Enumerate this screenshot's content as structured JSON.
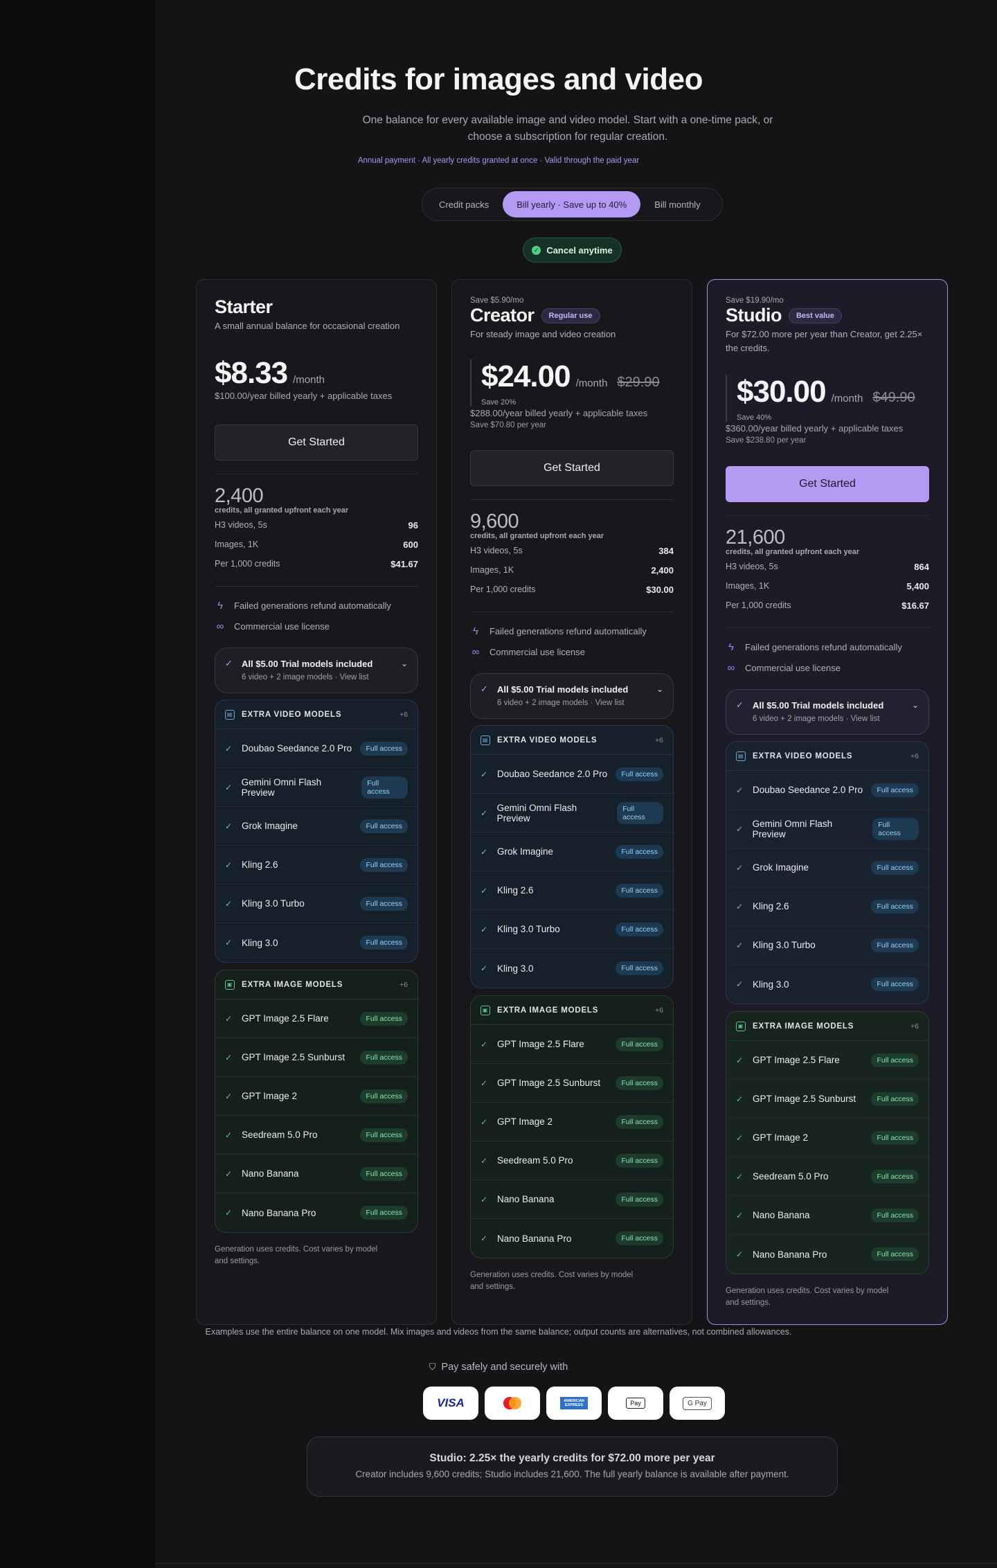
{
  "hero": {
    "title": "Credits for images and video",
    "subtitle": "One balance for every available image and video model. Start with a one-time pack, or choose a subscription for regular creation.",
    "note": "Annual payment · All yearly credits granted at once · Valid through the paid year"
  },
  "billing_toggle": {
    "options": [
      "Credit packs",
      "Bill yearly · Save up to 40%",
      "Bill monthly"
    ],
    "selected": "Bill yearly · Save up to 40%"
  },
  "cancel_badge": "Cancel anytime",
  "common": {
    "per_month": "/month",
    "credits_label": "credits, all granted upfront each year",
    "stat_labels": [
      "H3 videos, 5s",
      "Images, 1K",
      "Per 1,000 credits"
    ],
    "features": [
      "Failed generations refund automatically",
      "Commercial use license"
    ],
    "trial_title": "All $5.00 Trial models included",
    "trial_sub": "6 video + 2 image models · View list",
    "video_group_title": "EXTRA VIDEO MODELS",
    "image_group_title": "EXTRA IMAGE MODELS",
    "group_count": "+6",
    "full_access": "Full access",
    "video_models": [
      "Doubao Seedance 2.0 Pro",
      "Gemini Omni Flash Preview",
      "Grok Imagine",
      "Kling 2.6",
      "Kling 3.0 Turbo",
      "Kling 3.0"
    ],
    "image_models": [
      "GPT Image 2.5 Flare",
      "GPT Image 2.5 Sunburst",
      "GPT Image 2",
      "Seedream 5.0 Pro",
      "Nano Banana",
      "Nano Banana Pro"
    ],
    "gen_note": "Generation uses credits. Cost varies by model and settings."
  },
  "plans": [
    {
      "name": "Starter",
      "save_top": "",
      "tag": "",
      "desc": "A small annual balance for occasional creation",
      "price": "$8.33",
      "strike": "",
      "save_pct": "",
      "billed": "$100.00/year billed yearly + applicable taxes",
      "save_year": "",
      "cta": "Get Started",
      "credits": "2,400",
      "stats": [
        "96",
        "600",
        "$41.67"
      ]
    },
    {
      "name": "Creator",
      "save_top": "Save $5.90/mo",
      "tag": "Regular use",
      "desc": "For steady image and video creation",
      "price": "$24.00",
      "strike": "$29.90",
      "save_pct": "Save 20%",
      "billed": "$288.00/year billed yearly + applicable taxes",
      "save_year": "Save $70.80 per year",
      "cta": "Get Started",
      "credits": "9,600",
      "stats": [
        "384",
        "2,400",
        "$30.00"
      ]
    },
    {
      "name": "Studio",
      "save_top": "Save $19.90/mo",
      "tag": "Best value",
      "desc": "For $72.00 more per year than Creator, get 2.25× the credits.",
      "price": "$30.00",
      "strike": "$49.90",
      "save_pct": "Save 40%",
      "billed": "$360.00/year billed yearly + applicable taxes",
      "save_year": "Save $238.80 per year",
      "cta": "Get Started",
      "credits": "21,600",
      "stats": [
        "864",
        "5,400",
        "$16.67"
      ]
    }
  ],
  "examples_note": "Examples use the entire balance on one model. Mix images and videos from the same balance; output counts are alternatives, not combined allowances.",
  "pay_safe": "Pay safely and securely with",
  "payment_methods": [
    "VISA",
    "Mastercard",
    "AMERICAN EXPRESS",
    "Apple Pay",
    "G Pay"
  ],
  "promo": {
    "title": "Studio: 2.25× the yearly credits for $72.00 more per year",
    "subtitle": "Creator includes 9,600 credits; Studio includes 21,600. The full yearly balance is available after payment."
  }
}
